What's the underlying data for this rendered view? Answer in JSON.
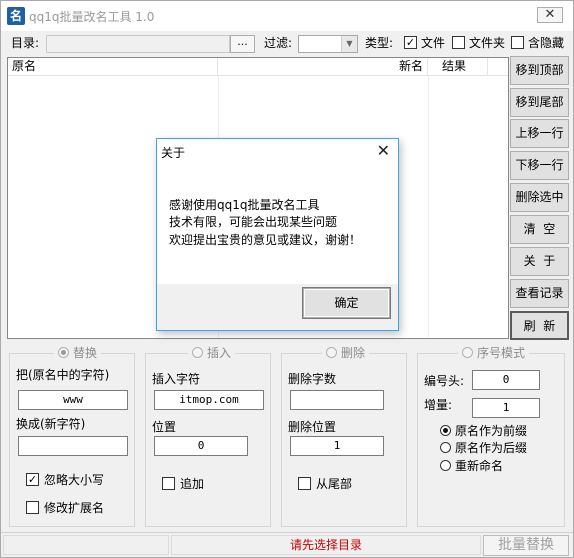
{
  "window": {
    "title": "qq1q批量改名工具 1.0",
    "icon_glyph": "名",
    "close_glyph": "✕"
  },
  "toolbar": {
    "dir_label": "目录:",
    "dir_value": "",
    "browse_label": "...",
    "filter_label": "过滤:",
    "filter_value": "",
    "type_label": "类型:",
    "file_label": "文件",
    "file_checked": true,
    "folder_label": "文件夹",
    "folder_checked": false,
    "hidden_label": "含隐藏",
    "hidden_checked": false,
    "check_glyph": "✓"
  },
  "list": {
    "columns": [
      "原名",
      "新名",
      "结果"
    ]
  },
  "side_buttons": [
    "移到顶部",
    "移到尾部",
    "上移一行",
    "下移一行",
    "删除选中",
    "清  空",
    "关  于",
    "查看记录",
    "刷  新"
  ],
  "groups": {
    "replace": {
      "title": "替换",
      "selected": true,
      "from_label": "把(原名中的字符)",
      "from_value": "www",
      "to_label": "换成(新字符)",
      "to_value": "",
      "ignore_case_label": "忽略大小写",
      "ignore_case_checked": true,
      "change_ext_label": "修改扩展名",
      "change_ext_checked": false
    },
    "insert": {
      "title": "插入",
      "selected": false,
      "chars_label": "插入字符",
      "chars_value": "itmop.com",
      "pos_label": "位置",
      "pos_value": "0",
      "append_label": "追加",
      "append_checked": false
    },
    "delete": {
      "title": "删除",
      "selected": false,
      "count_label": "删除字数",
      "count_value": "",
      "pos_label": "删除位置",
      "pos_value": "1",
      "from_end_label": "从尾部",
      "from_end_checked": false
    },
    "sequence": {
      "title": "序号模式",
      "selected": false,
      "prefix_label": "编号头:",
      "prefix_value": "0",
      "step_label": "增量:",
      "step_value": "1",
      "options": [
        "原名作为前缀",
        "原名作为后缀",
        "重新命名"
      ],
      "selected_option": 0
    }
  },
  "status": {
    "message": "请先选择目录",
    "batch_label": "批量替换"
  },
  "dialog": {
    "title": "关于",
    "close_glyph": "✕",
    "lines": [
      "感谢使用qq1q批量改名工具",
      "技术有限，可能会出现某些问题",
      "欢迎提出宝贵的意见或建议，谢谢！"
    ],
    "ok_label": "确定"
  }
}
